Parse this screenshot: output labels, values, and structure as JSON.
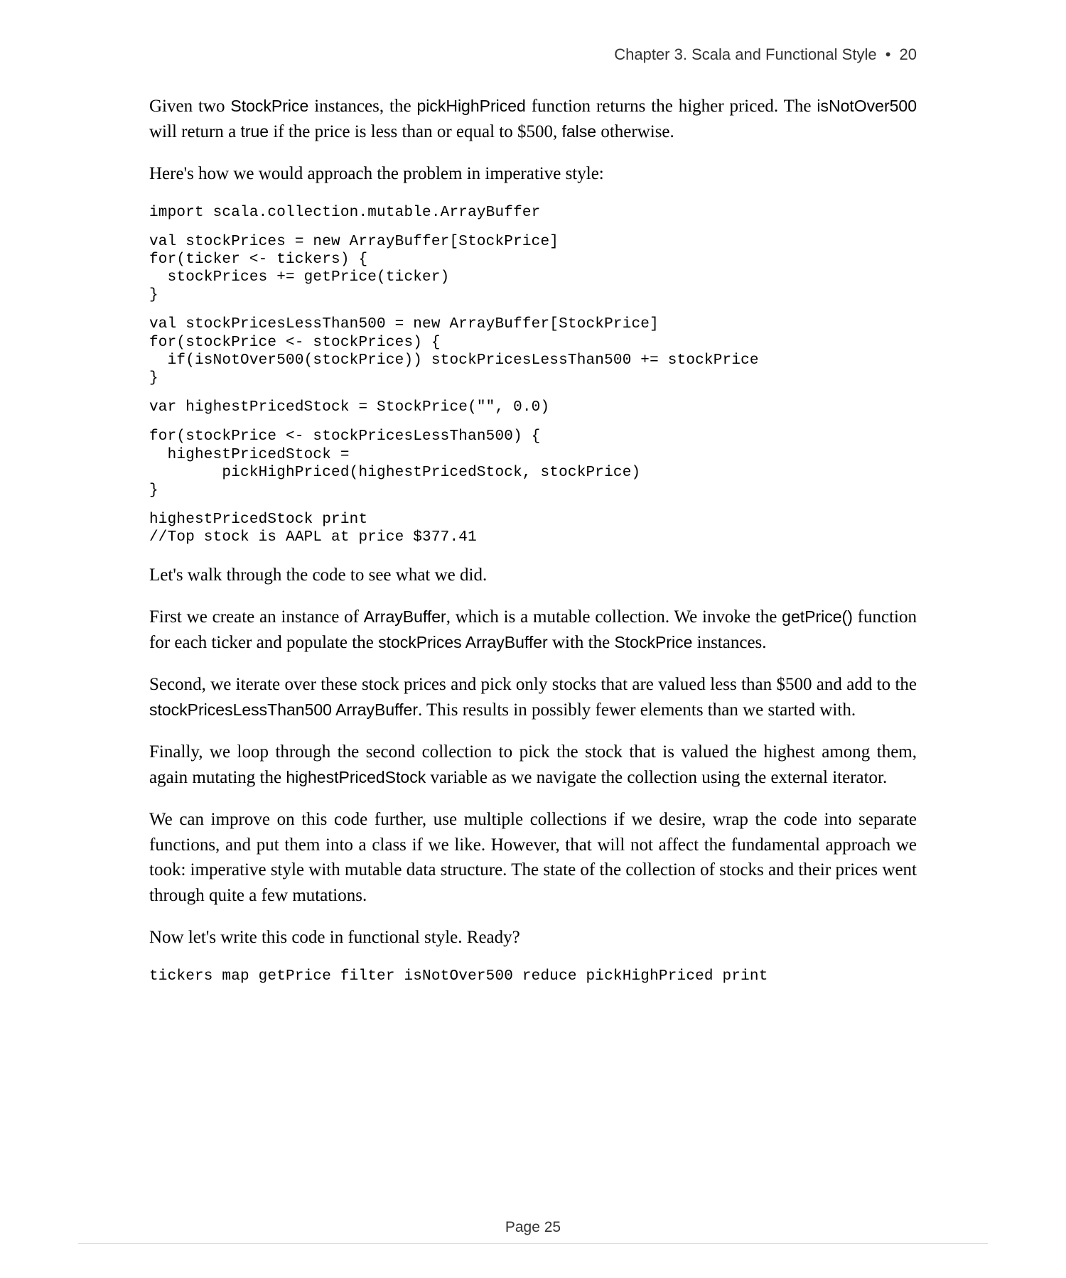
{
  "header": {
    "chapter": "Chapter 3. Scala and Functional Style",
    "bullet": "•",
    "page_in_chapter": "20"
  },
  "p1": {
    "t1": "Given two ",
    "c1": "StockPrice",
    "t2": " instances, the ",
    "c2": "pickHighPriced",
    "t3": " function returns the higher priced. The ",
    "c3": "isNotOver500",
    "t4": " will return a ",
    "c4": "true",
    "t5": " if the price is less than or equal to $500, ",
    "c5": "false",
    "t6": " otherwise."
  },
  "p2": "Here's how we would approach the problem in imperative style:",
  "code1": "import scala.collection.mutable.ArrayBuffer",
  "code2": "val stockPrices = new ArrayBuffer[StockPrice]\nfor(ticker <- tickers) {\n  stockPrices += getPrice(ticker)\n}",
  "code3": "val stockPricesLessThan500 = new ArrayBuffer[StockPrice]\nfor(stockPrice <- stockPrices) {\n  if(isNotOver500(stockPrice)) stockPricesLessThan500 += stockPrice\n}",
  "code4": "var highestPricedStock = StockPrice(\"\", 0.0)",
  "code5": "for(stockPrice <- stockPricesLessThan500) {\n  highestPricedStock =\n        pickHighPriced(highestPricedStock, stockPrice)\n}",
  "code6": "highestPricedStock print\n//Top stock is AAPL at price $377.41",
  "p3": "Let's walk through the code to see what we did.",
  "p4": {
    "t1": "First we create an instance of ",
    "c1": "ArrayBuffer",
    "t2": ", which is a mutable collection. We invoke the ",
    "c2": "getPrice()",
    "t3": " function for each ticker and populate the ",
    "c3": "stockPrices ArrayBuffer",
    "t4": " with the ",
    "c4": "StockPrice",
    "t5": " instances."
  },
  "p5": {
    "t1": "Second, we iterate over these stock prices and pick only stocks that are valued less than $500 and add to the ",
    "c1": "stockPricesLessThan500 ArrayBuffer",
    "t2": ". This results in possibly fewer elements than we started with."
  },
  "p6": {
    "t1": "Finally, we loop through the second collection to pick the stock that is valued the highest among them, again mutating the ",
    "c1": "highestPricedStock",
    "t2": " variable as we navigate the collection using the external iterator."
  },
  "p7": "We can improve on this code further, use multiple collections if we desire, wrap the code into separate functions, and put them into a class if we like. However, that will not affect the fundamental approach we took: imperative style with mutable data structure. The state of the collection of stocks and their prices went through quite a few mutations.",
  "p8": "Now let's write this code in functional style. Ready?",
  "code7": "tickers map getPrice filter isNotOver500 reduce pickHighPriced print",
  "footer": {
    "label": "Page 25"
  }
}
